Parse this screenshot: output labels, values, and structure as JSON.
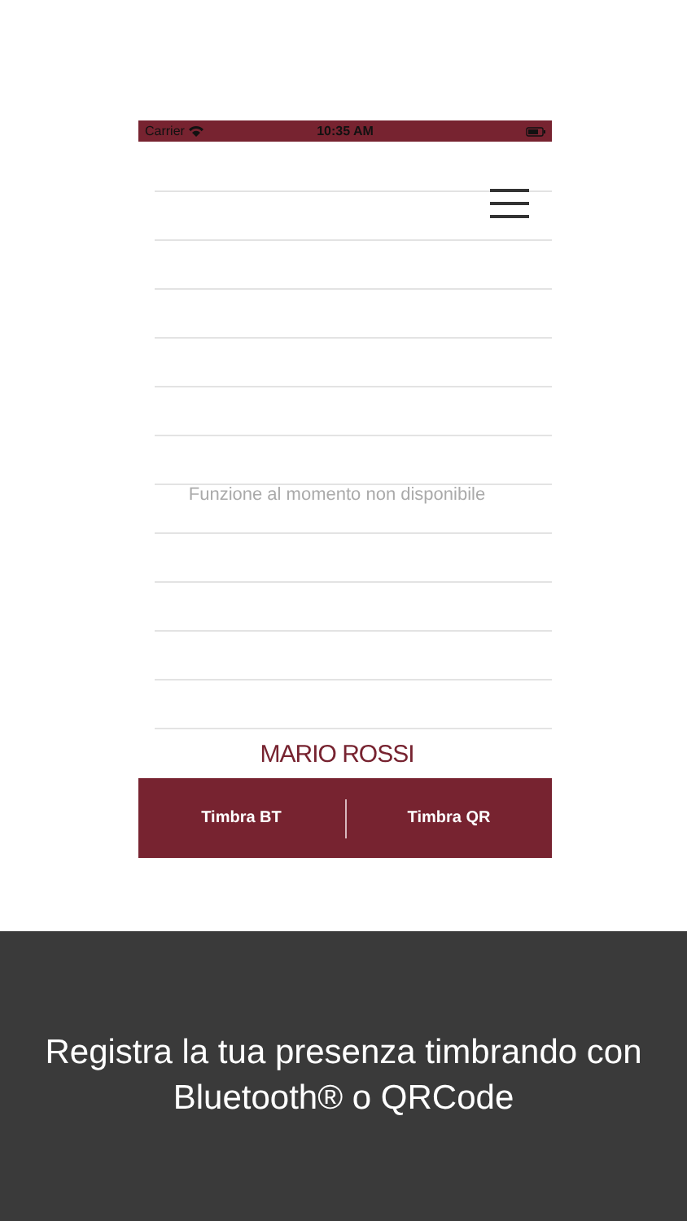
{
  "status_bar": {
    "carrier": "Carrier",
    "time": "10:35 AM"
  },
  "message": "Funzione al momento non disponibile",
  "user_name": "MARIO ROSSI",
  "buttons": [
    {
      "label": "Timbra BT"
    },
    {
      "label": "Timbra QR"
    }
  ],
  "caption": "Registra la tua presenza timbrando con Bluetooth® o QRCode"
}
